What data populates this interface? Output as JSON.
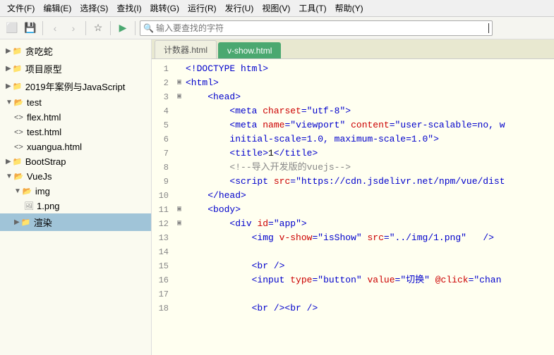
{
  "menubar": {
    "items": [
      "文件(F)",
      "编辑(E)",
      "选择(S)",
      "查找(I)",
      "跳转(G)",
      "运行(R)",
      "发行(U)",
      "视图(V)",
      "工具(T)",
      "帮助(Y)"
    ]
  },
  "toolbar": {
    "buttons": [
      "new",
      "save",
      "back",
      "forward",
      "star",
      "run"
    ],
    "search_placeholder": "输入要查找的字符"
  },
  "sidebar": {
    "items": [
      {
        "id": "snakes",
        "label": "贪吃蛇",
        "type": "folder",
        "collapsed": true,
        "indent": 0
      },
      {
        "id": "prototype",
        "label": "项目原型",
        "type": "folder",
        "collapsed": true,
        "indent": 0
      },
      {
        "id": "year2019",
        "label": "2019年案例与JavaScript",
        "type": "folder",
        "collapsed": true,
        "indent": 0
      },
      {
        "id": "test",
        "label": "test",
        "type": "folder",
        "collapsed": false,
        "indent": 0
      },
      {
        "id": "flex",
        "label": "flex.html",
        "type": "html",
        "indent": 1
      },
      {
        "id": "test-html",
        "label": "test.html",
        "type": "html",
        "indent": 1
      },
      {
        "id": "xuangua",
        "label": "xuangua.html",
        "type": "html",
        "indent": 1
      },
      {
        "id": "bootstrap",
        "label": "BootStrap",
        "type": "folder",
        "collapsed": true,
        "indent": 0
      },
      {
        "id": "vuejs",
        "label": "VueJs",
        "type": "folder",
        "collapsed": false,
        "indent": 0
      },
      {
        "id": "img",
        "label": "img",
        "type": "folder",
        "collapsed": false,
        "indent": 1
      },
      {
        "id": "1png",
        "label": "1.png",
        "type": "image",
        "indent": 2
      },
      {
        "id": "xuan",
        "label": "渲染",
        "type": "folder",
        "selected": true,
        "indent": 1
      }
    ]
  },
  "tabs": [
    {
      "id": "counter",
      "label": "计数器.html",
      "active": false
    },
    {
      "id": "vshow",
      "label": "v-show.html",
      "active": true
    }
  ],
  "code": {
    "lines": [
      {
        "num": 1,
        "fold": "",
        "content": "<!DOCTYPE html>",
        "type": "doctype"
      },
      {
        "num": 2,
        "fold": "▣",
        "content": "<html>",
        "type": "tag"
      },
      {
        "num": 3,
        "fold": "▣",
        "content": "    <head>",
        "type": "tag"
      },
      {
        "num": 4,
        "fold": "",
        "content": "        <meta charset=\"utf-8\">",
        "type": "tag"
      },
      {
        "num": 5,
        "fold": "",
        "content": "        <meta name=\"viewport\" content=\"user-scalable=no, w",
        "type": "tag"
      },
      {
        "num": 6,
        "fold": "",
        "content": "        initial-scale=1.0, maximum-scale=1.0\">",
        "type": "continuation"
      },
      {
        "num": 7,
        "fold": "",
        "content": "        <title>1</title>",
        "type": "tag"
      },
      {
        "num": 8,
        "fold": "",
        "content": "        <!--导入开发版的vuejs-->",
        "type": "comment"
      },
      {
        "num": 9,
        "fold": "",
        "content": "        <script src=\"https://cdn.jsdelivr.net/npm/vue/dist",
        "type": "tag"
      },
      {
        "num": 10,
        "fold": "",
        "content": "    </head>",
        "type": "tag"
      },
      {
        "num": 11,
        "fold": "▣",
        "content": "    <body>",
        "type": "tag"
      },
      {
        "num": 12,
        "fold": "▣",
        "content": "        <div id=\"app\">",
        "type": "tag"
      },
      {
        "num": 13,
        "fold": "",
        "content": "            <img v-show=\"isShow\" src=\"../img/1.png\"   />",
        "type": "tag"
      },
      {
        "num": 14,
        "fold": "",
        "content": "",
        "type": "empty"
      },
      {
        "num": 15,
        "fold": "",
        "content": "            <br />",
        "type": "tag"
      },
      {
        "num": 16,
        "fold": "",
        "content": "            <input type=\"button\" value=\"切换\" @click=\"chan",
        "type": "tag"
      },
      {
        "num": 17,
        "fold": "",
        "content": "",
        "type": "empty"
      },
      {
        "num": 18,
        "fold": "",
        "content": "            <br /><br />",
        "type": "tag"
      }
    ]
  }
}
